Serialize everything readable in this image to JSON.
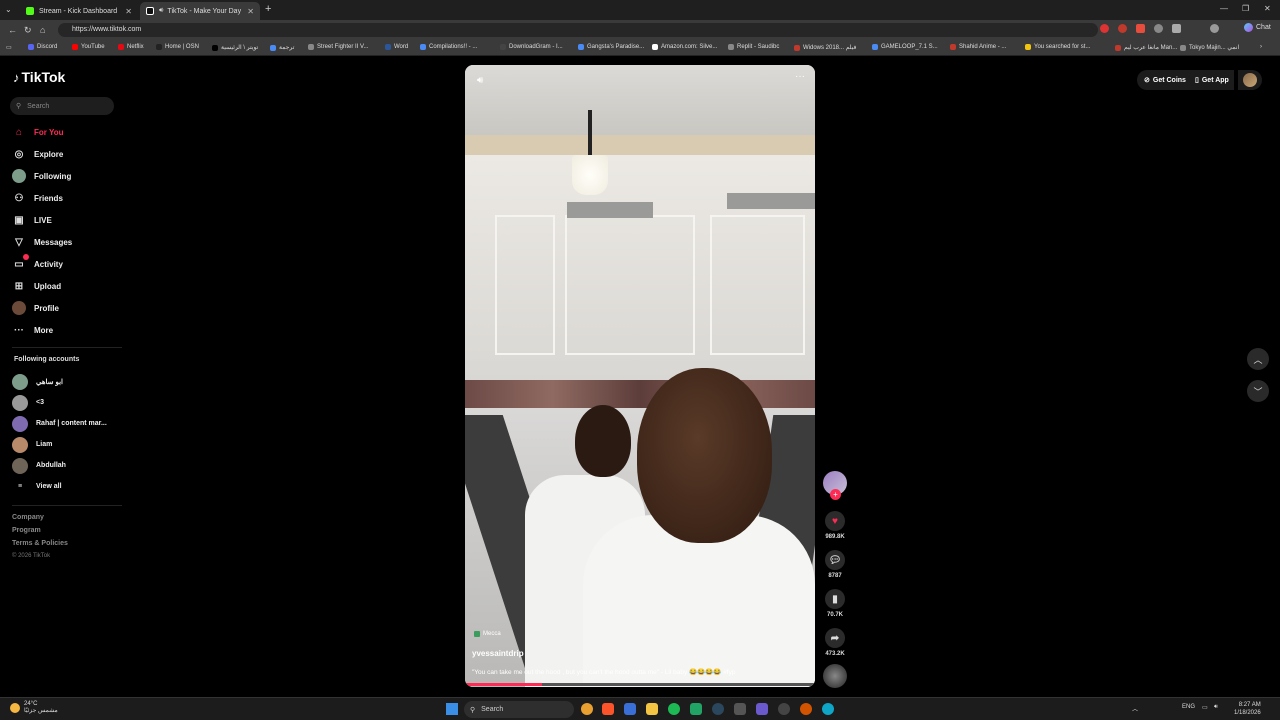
{
  "browser": {
    "tabs": [
      {
        "label": "Stream - Kick Dashboard",
        "color": "#53fc18"
      },
      {
        "label": "TikTok - Make Your Day",
        "color": "#ffffff"
      }
    ],
    "url": "https://www.tiktok.com",
    "chat_label": "Chat",
    "bookmarks": [
      {
        "label": "Discord",
        "color": "#5865f2"
      },
      {
        "label": "YouTube",
        "color": "#ff0000"
      },
      {
        "label": "Netflix",
        "color": "#e50914"
      },
      {
        "label": "Home | OSN",
        "color": "#222222"
      },
      {
        "label": "تويتر \\ الرئيسية",
        "color": "#000000"
      },
      {
        "label": "ترجمة",
        "color": "#4a8af4"
      },
      {
        "label": "Street Fighter II V...",
        "color": "#888888"
      },
      {
        "label": "Word",
        "color": "#2b579a"
      },
      {
        "label": "Compilations!! - ...",
        "color": "#4a8af4"
      },
      {
        "label": "DownloadGram - I...",
        "color": "#444444"
      },
      {
        "label": "Gangsta's Paradise...",
        "color": "#4a8af4"
      },
      {
        "label": "Amazon.com: Silve...",
        "color": "#ffffff"
      },
      {
        "label": "Replit - Saudibc",
        "color": "#888888"
      },
      {
        "label": "Widows 2018... فيلم",
        "color": "#c0392b"
      },
      {
        "label": "GAMELOOP_7.1 S...",
        "color": "#4a8af4"
      },
      {
        "label": "Shahid Anime - ...",
        "color": "#c0392b"
      },
      {
        "label": "You searched for st...",
        "color": "#f1c40f"
      },
      {
        "label": "مانغا عرب ليم Man...",
        "color": "#c0392b"
      },
      {
        "label": "Tokyo Majin... انمي",
        "color": "#888888"
      }
    ]
  },
  "tiktok": {
    "logo": "TikTok",
    "search_placeholder": "Search",
    "nav": [
      {
        "label": "For You",
        "icon": "home-icon",
        "glyph": "⌂"
      },
      {
        "label": "Explore",
        "icon": "compass-icon",
        "glyph": "◎"
      },
      {
        "label": "Following",
        "icon": "following-avatar-icon",
        "glyph": ""
      },
      {
        "label": "Friends",
        "icon": "friends-icon",
        "glyph": "⚇"
      },
      {
        "label": "LIVE",
        "icon": "live-icon",
        "glyph": "▣"
      },
      {
        "label": "Messages",
        "icon": "messages-icon",
        "glyph": "▽"
      },
      {
        "label": "Activity",
        "icon": "activity-icon",
        "glyph": "▭"
      },
      {
        "label": "Upload",
        "icon": "upload-icon",
        "glyph": "⊞"
      },
      {
        "label": "Profile",
        "icon": "profile-avatar-icon",
        "glyph": ""
      },
      {
        "label": "More",
        "icon": "more-icon",
        "glyph": "···"
      }
    ],
    "following_title": "Following accounts",
    "following": [
      {
        "name": "ابو ساهي",
        "color": "#7d9c8a"
      },
      {
        "name": "<3",
        "color": "#999999"
      },
      {
        "name": "Rahaf | content mar...",
        "color": "#7f6bb0"
      },
      {
        "name": "Liam",
        "color": "#b88a6a"
      },
      {
        "name": "Abdullah",
        "color": "#6e6458"
      }
    ],
    "view_all": "View all",
    "footer": [
      "Company",
      "Program",
      "Terms & Policies"
    ],
    "copyright": "© 2026 TikTok",
    "top_actions": {
      "get_coins": "Get Coins",
      "get_app": "Get App"
    },
    "video": {
      "location": "Mecca",
      "author": "yvessaintdrip",
      "caption": "\"You can take me out the hood , but you can't the hood outta me\" - Lil baby 😂😂😂😂 #fyp",
      "progress_fraction": 0.22,
      "likes": "989.8K",
      "comments": "8787",
      "saves": "70.7K",
      "shares": "473.2K"
    }
  },
  "taskbar": {
    "weather_temp": "24°C",
    "weather_desc": "مشمس جزئيًا",
    "search": "Search",
    "lang": "ENG",
    "time": "8:27 AM",
    "date": "1/18/2026"
  }
}
